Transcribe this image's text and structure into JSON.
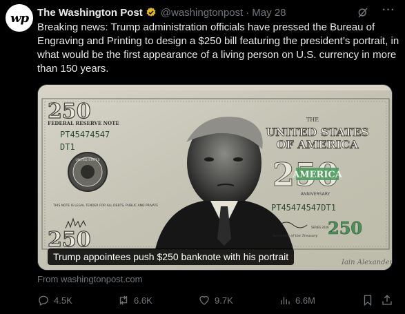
{
  "post": {
    "author_name": "The Washington Post",
    "avatar_text": "wp",
    "handle": "@washingtonpost",
    "separator": "·",
    "date": "May 28",
    "more_label": "···",
    "text": "Breaking news: Trump administration officials have pressed the Bureau of Engraving and Printing to design a $250 bill featuring the president’s portrait, in what would be the first appearance of a living person on U.S. currency in more than 150 years."
  },
  "media": {
    "caption": "Trump appointees push $250 banknote with his portrait",
    "bill": {
      "big_denomination": "250",
      "note_header": "FEDERAL RESERVE NOTE",
      "serial": "PT45474547",
      "serial_suffix": "DT1",
      "seal_text": "UNITED STATES",
      "the": "THE",
      "country_line1": "UNITED STATES",
      "country_line2": "OF AMERICA",
      "america": "AMERICA",
      "anniversary": "ANNIVERSARY",
      "serial_full": "PT45474547DT1",
      "legal_tender": "THIS NOTE IS LEGAL TENDER FOR ALL DEBTS, PUBLIC AND PRIVATE",
      "treasury": "Secretary of the Treasury",
      "series": "SERIES 2026",
      "green_denom": "250",
      "signature": "Iain Alexander"
    }
  },
  "source": "From washingtonpost.com",
  "actions": {
    "replies": "4.5K",
    "reposts": "6.6K",
    "likes": "9.7K",
    "views": "6.6M"
  }
}
